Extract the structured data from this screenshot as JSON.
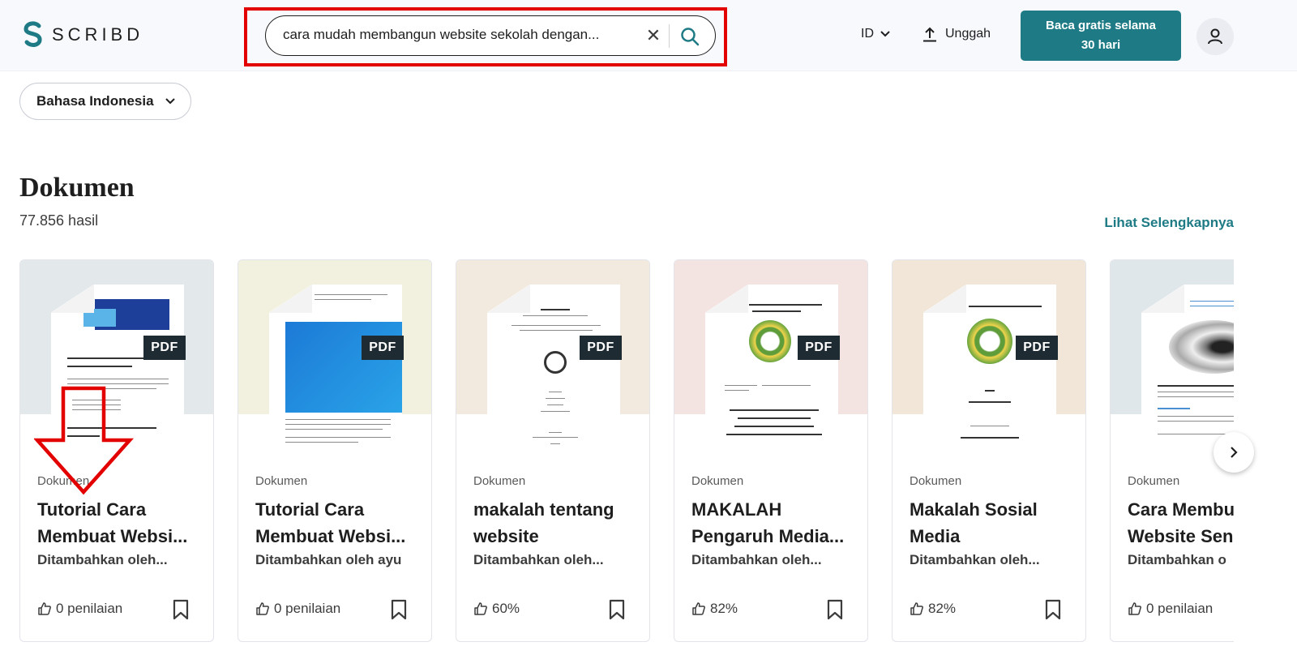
{
  "header": {
    "logo_text": "SCRIBD",
    "search_query": "cara mudah membangun website sekolah dengan...",
    "language_code": "ID",
    "upload_label": "Unggah",
    "cta_line1": "Baca gratis selama",
    "cta_line2": "30 hari"
  },
  "filter": {
    "language_label": "Bahasa Indonesia"
  },
  "section": {
    "title": "Dokumen",
    "result_count": "77.856 hasil",
    "see_more_label": "Lihat Selengkapnya"
  },
  "cards": [
    {
      "badge": "PDF",
      "type": "Dokumen",
      "title": "Tutorial Cara Membuat Websi...",
      "author": "Ditambahkan oleh...",
      "rating": "0 penilaian",
      "thumb_bg": "#e3e9ea"
    },
    {
      "badge": "PDF",
      "type": "Dokumen",
      "title": "Tutorial Cara Membuat Websi...",
      "author": "Ditambahkan oleh ayu",
      "rating": "0 penilaian",
      "thumb_bg": "#f2f0df"
    },
    {
      "badge": "PDF",
      "type": "Dokumen",
      "title": "makalah tentang website",
      "author": "Ditambahkan oleh...",
      "rating": "60%",
      "thumb_bg": "#f2eade"
    },
    {
      "badge": "PDF",
      "type": "Dokumen",
      "title": "MAKALAH Pengaruh Media...",
      "author": "Ditambahkan oleh...",
      "rating": "82%",
      "thumb_bg": "#f3e3e1"
    },
    {
      "badge": "PDF",
      "type": "Dokumen",
      "title": "Makalah Sosial Media",
      "author": "Ditambahkan oleh...",
      "rating": "82%",
      "thumb_bg": "#f1e6d7"
    },
    {
      "badge": "",
      "type": "Dokumen",
      "title": "Cara Membu Website Sen",
      "author": "Ditambahkan o",
      "rating": "0 penilaian",
      "thumb_bg": "#e0e7ea"
    }
  ],
  "colors": {
    "brand": "#1e7b85",
    "highlight": "#e30000",
    "pdf_badge": "#1f2b33"
  }
}
